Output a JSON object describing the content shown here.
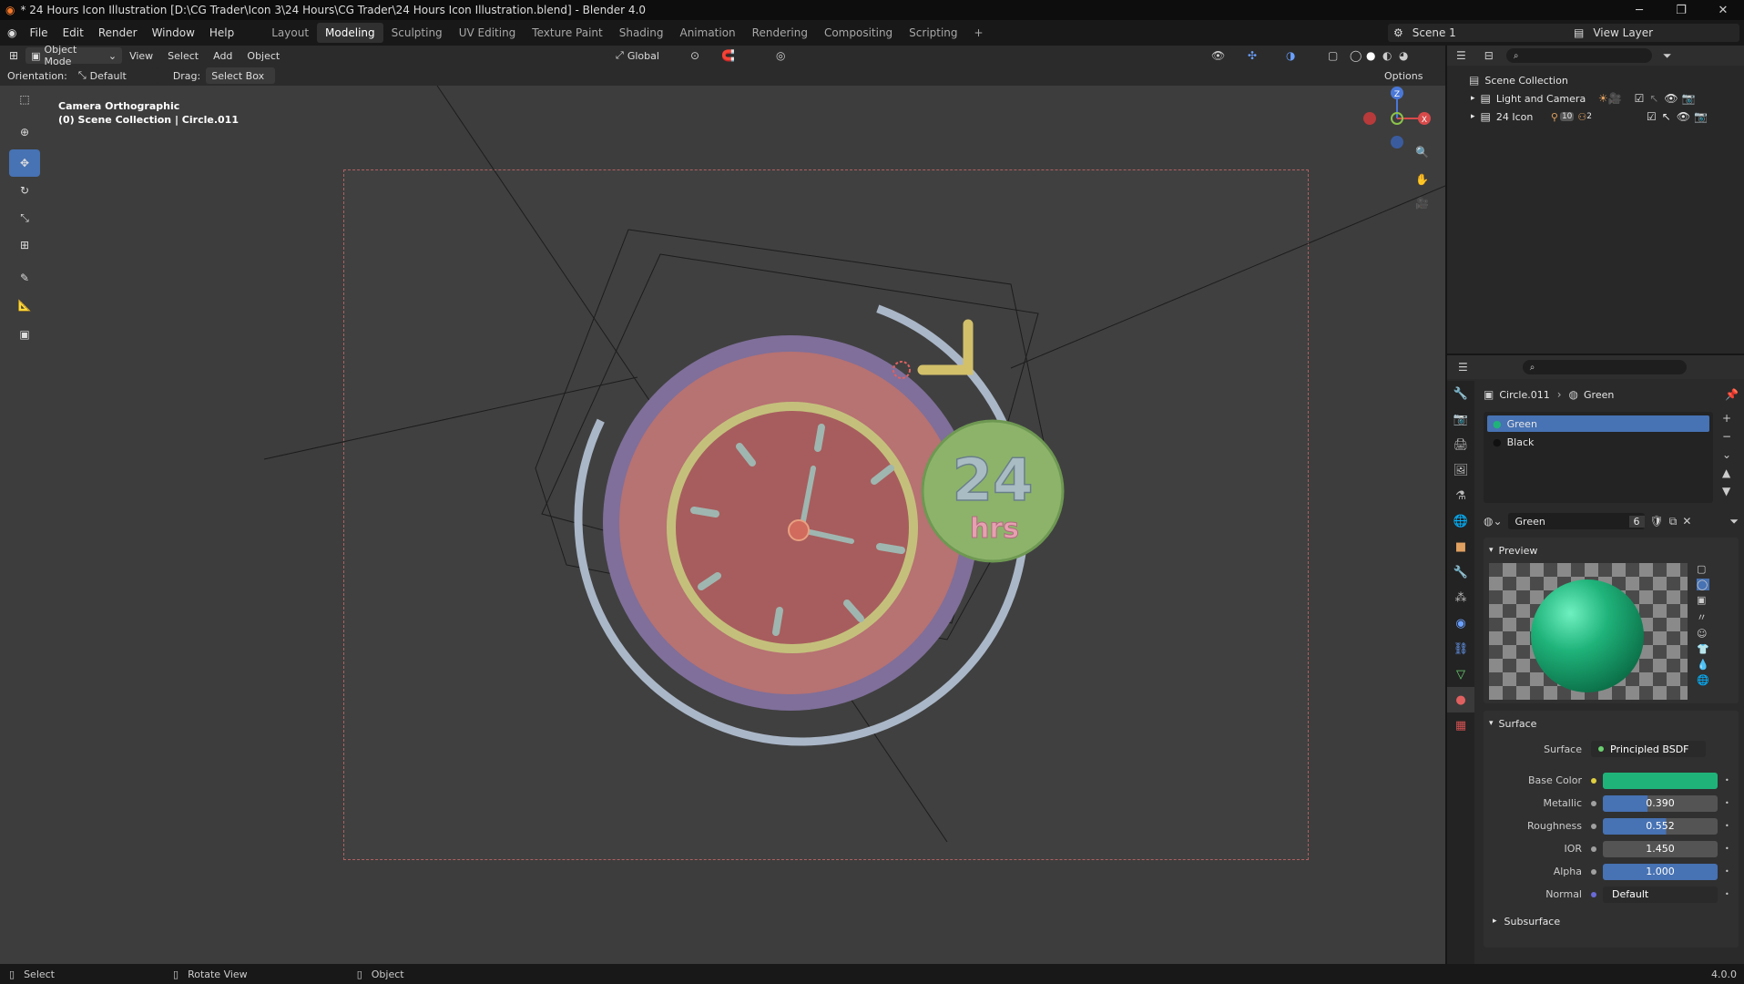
{
  "window": {
    "title": "* 24 Hours Icon Illustration [D:\\CG Trader\\Icon 3\\24 Hours\\CG Trader\\24 Hours Icon Illustration.blend] - Blender 4.0",
    "controls": [
      "─",
      "❐",
      "✕"
    ]
  },
  "menu": [
    "File",
    "Edit",
    "Render",
    "Window",
    "Help"
  ],
  "workspaces": [
    "Layout",
    "Modeling",
    "Sculpting",
    "UV Editing",
    "Texture Paint",
    "Shading",
    "Animation",
    "Rendering",
    "Compositing",
    "Scripting"
  ],
  "active_workspace": "Modeling",
  "add_workspace": "+",
  "scene": {
    "name": "Scene 1",
    "view_layer": "View Layer"
  },
  "viewport_header": {
    "mode": "Object Mode",
    "menus": [
      "View",
      "Select",
      "Add",
      "Object"
    ],
    "transform_orientation": "Global",
    "options": "Options",
    "orientation_label": "Orientation:",
    "orientation_value": "Default",
    "drag_label": "Drag:",
    "drag_value": "Select Box"
  },
  "viewport_overlay": {
    "view_name": "Camera Orthographic",
    "collection_info": "(0) Scene Collection | Circle.011"
  },
  "artwork": {
    "badge_number": "24",
    "badge_unit": "hrs"
  },
  "gizmo": {
    "x": "X",
    "y": "Y",
    "z": "Z"
  },
  "outliner": {
    "root": "Scene Collection",
    "items": [
      {
        "name": "Light and Camera"
      },
      {
        "name": "24 Icon",
        "badge_count": "10",
        "badge_count2": "2"
      }
    ]
  },
  "properties": {
    "breadcrumb_object": "Circle.011",
    "breadcrumb_material": "Green",
    "material_slots": [
      "Green",
      "Black"
    ],
    "material_name": "Green",
    "material_users": "6",
    "preview_label": "Preview",
    "surface_section": "Surface",
    "surface_label": "Surface",
    "surface_value": "Principled BSDF",
    "inputs": [
      {
        "label": "Base Color",
        "value": "",
        "color": "#1fb37a",
        "fill": 1.0
      },
      {
        "label": "Metallic",
        "value": "0.390",
        "fill": 0.39
      },
      {
        "label": "Roughness",
        "value": "0.552",
        "fill": 0.552
      },
      {
        "label": "IOR",
        "value": "1.450",
        "fill": 0
      },
      {
        "label": "Alpha",
        "value": "1.000",
        "fill": 1.0
      },
      {
        "label": "Normal",
        "value": "Default",
        "fill": 0
      }
    ],
    "subsurface_label": "Subsurface"
  },
  "statusbar": {
    "select": "Select",
    "rotate": "Rotate View",
    "object": "Object",
    "version": "4.0.0"
  },
  "colors": {
    "accent": "#4772b3",
    "base_color": "#1fb37a"
  }
}
